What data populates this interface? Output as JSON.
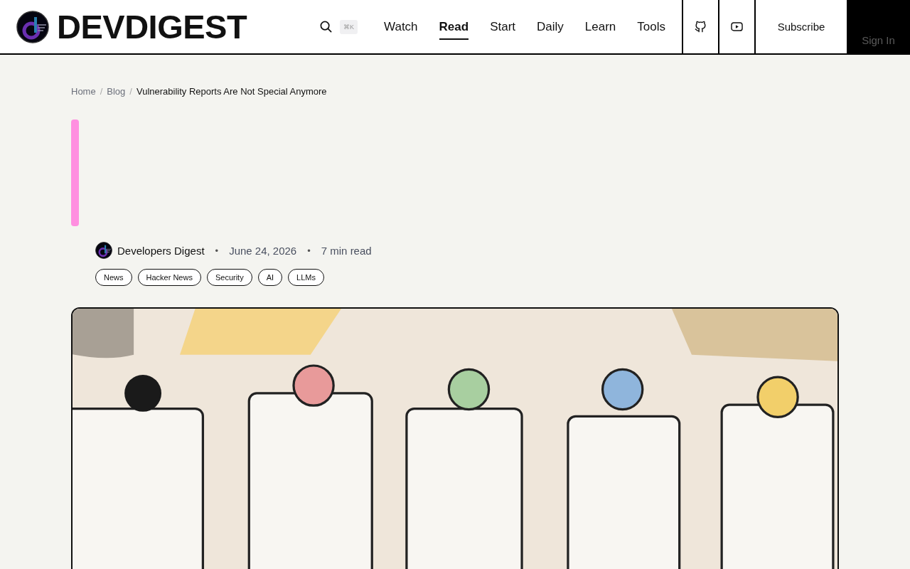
{
  "header": {
    "logo_text": "DEVDIGEST",
    "search_shortcut": "⌘K",
    "nav": [
      {
        "label": "Watch",
        "selected": false
      },
      {
        "label": "Read",
        "selected": true
      },
      {
        "label": "Start",
        "selected": false
      },
      {
        "label": "Daily",
        "selected": false
      },
      {
        "label": "Learn",
        "selected": false
      },
      {
        "label": "Tools",
        "selected": false
      }
    ],
    "subscribe": "Subscribe",
    "sign_in": "Sign In"
  },
  "breadcrumb": {
    "separator": "/",
    "items": [
      "Home",
      "Blog",
      "Vulnerability Reports Are Not Special Anymore"
    ]
  },
  "article": {
    "author": "Developers Digest",
    "date": "June 24, 2026",
    "read_time": "7 min read",
    "meta_separator": "•",
    "tags": [
      "News",
      "Hacker News",
      "Security",
      "AI",
      "LLMs"
    ],
    "hero": {
      "kind": "picture"
    }
  }
}
